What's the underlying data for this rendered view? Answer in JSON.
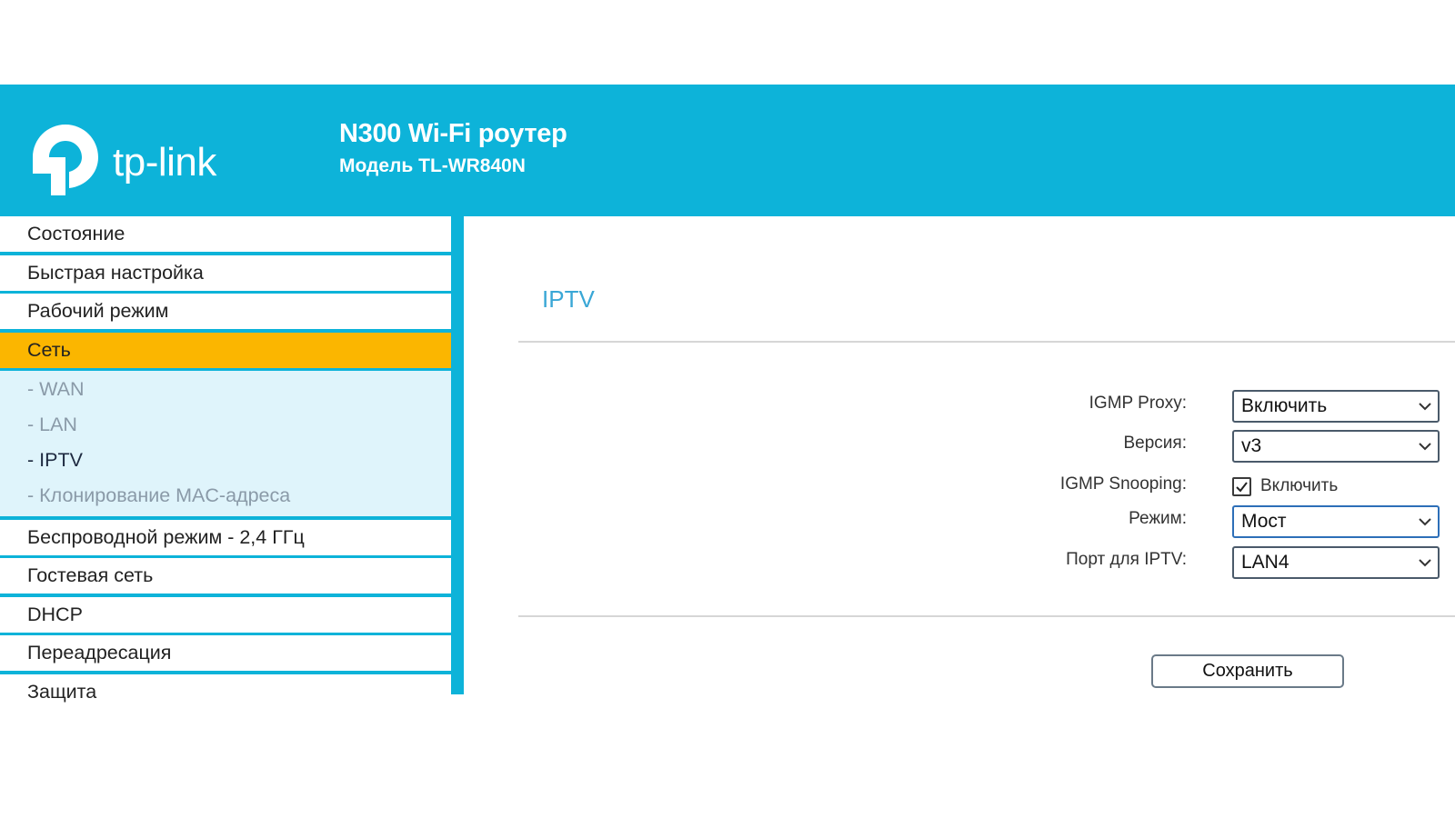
{
  "header": {
    "brand": "tp-link",
    "device_title": "N300 Wi-Fi роутер",
    "device_model": "Модель TL-WR840N"
  },
  "sidebar": {
    "items_before": [
      {
        "label": "Состояние"
      },
      {
        "label": "Быстрая настройка"
      },
      {
        "label": "Рабочий режим"
      }
    ],
    "active": {
      "label": "Сеть"
    },
    "submenu": [
      {
        "label": "- WAN"
      },
      {
        "label": "- LAN"
      },
      {
        "label": "- IPTV",
        "current": true
      },
      {
        "label": "- Клонирование MAC-адреса"
      }
    ],
    "items_after": [
      {
        "label": "Беспроводной режим - 2,4 ГГц"
      },
      {
        "label": "Гостевая сеть"
      },
      {
        "label": "DHCP"
      },
      {
        "label": "Переадресация"
      },
      {
        "label": "Защита"
      }
    ]
  },
  "main": {
    "heading": "IPTV",
    "form": {
      "igmp_proxy": {
        "label": "IGMP Proxy:",
        "value": "Включить"
      },
      "version": {
        "label": "Версия:",
        "value": "v3"
      },
      "igmp_snooping": {
        "label": "IGMP Snooping:",
        "checkbox_label": "Включить",
        "checked": true
      },
      "mode": {
        "label": "Режим:",
        "value": "Мост"
      },
      "iptv_port": {
        "label": "Порт для IPTV:",
        "value": "LAN4"
      }
    },
    "save_label": "Сохранить"
  },
  "colors": {
    "brand_blue": "#0db3d9",
    "active_item": "#fbb600",
    "submenu_bg": "#dff4fb",
    "heading": "#3aa7d6"
  },
  "icons": {
    "logo": "tp-link-logo-icon",
    "dropdown": "chevron-down-icon",
    "checkbox": "check-icon"
  }
}
